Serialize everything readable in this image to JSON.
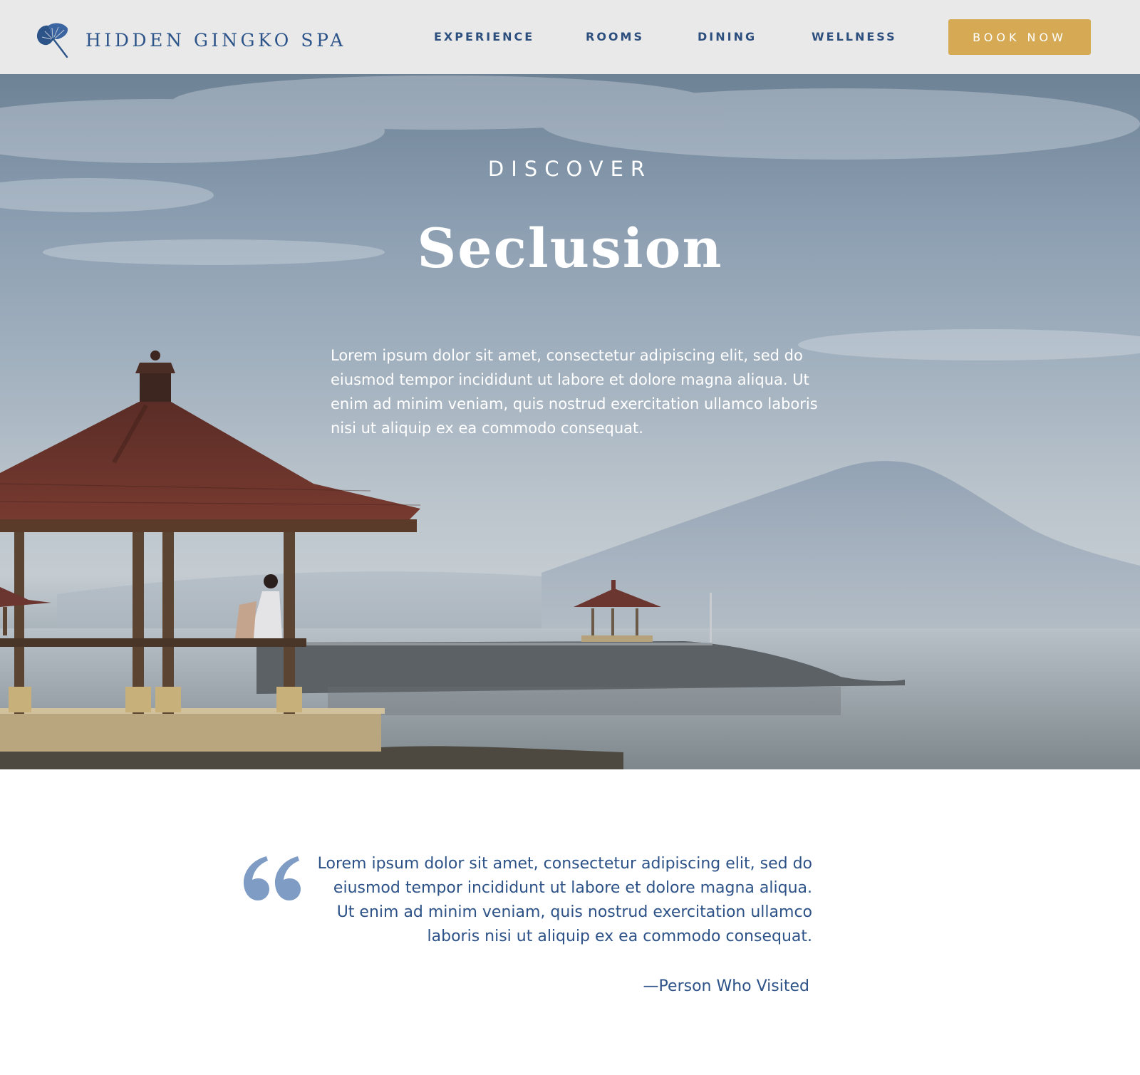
{
  "brand": {
    "name": "HIDDEN GINGKO SPA",
    "logo_icon": "ginkgo-leaf-icon",
    "color": "#2d5489"
  },
  "nav": {
    "items": [
      {
        "label": "EXPERIENCE"
      },
      {
        "label": "ROOMS"
      },
      {
        "label": "DINING"
      },
      {
        "label": "WELLNESS"
      }
    ],
    "book_label": "BOOK NOW",
    "book_color": "#d6a955"
  },
  "hero": {
    "eyebrow": "DISCOVER",
    "title": "Seclusion",
    "body": "Lorem ipsum dolor sit amet, consectetur adipiscing elit, sed do eiusmod tempor incididunt ut labore et dolore magna aliqua. Ut enim ad minim veniam, quis nostrud exercitation ullamco laboris nisi ut aliquip ex ea commodo consequat."
  },
  "testimonial": {
    "quote_icon": "quote-mark-icon",
    "quote": "Lorem ipsum dolor sit amet, consectetur adipiscing elit, sed do eiusmod tempor incididunt ut labore et dolore magna aliqua. Ut enim ad minim veniam, quis nostrud exercitation ullamco laboris nisi ut aliquip ex ea commodo consequat.",
    "author": "—Person Who Visited",
    "quote_color": "#7f9cc4"
  }
}
